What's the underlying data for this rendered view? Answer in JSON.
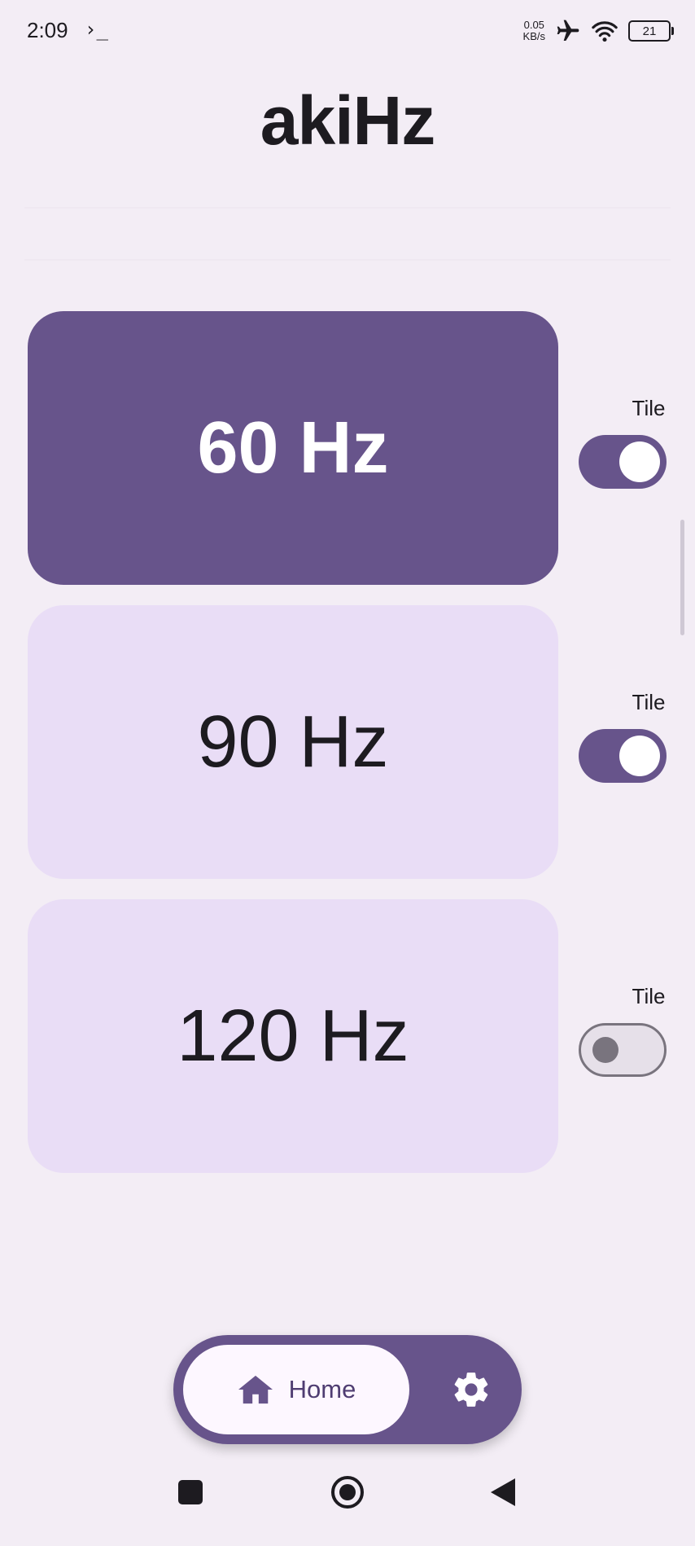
{
  "status_bar": {
    "time": "2:09",
    "terminal_glyph": "›_",
    "net_speed_value": "0.05",
    "net_speed_unit": "KB/s",
    "battery": "21",
    "icons": [
      "airplane-icon",
      "wifi-icon",
      "battery-icon"
    ]
  },
  "app": {
    "title": "akiHz"
  },
  "rates": [
    {
      "label": "60 Hz",
      "selected": true,
      "tile_label": "Tile",
      "tile_enabled": true
    },
    {
      "label": "90 Hz",
      "selected": false,
      "tile_label": "Tile",
      "tile_enabled": true
    },
    {
      "label": "120 Hz",
      "selected": false,
      "tile_label": "Tile",
      "tile_enabled": false
    }
  ],
  "bottom_nav": {
    "home_label": "Home",
    "home_icon": "home-icon",
    "settings_icon": "gear-icon"
  },
  "colors": {
    "accent": "#67548b",
    "card_inactive": "#e9ddf6",
    "background": "#f3edf5"
  }
}
